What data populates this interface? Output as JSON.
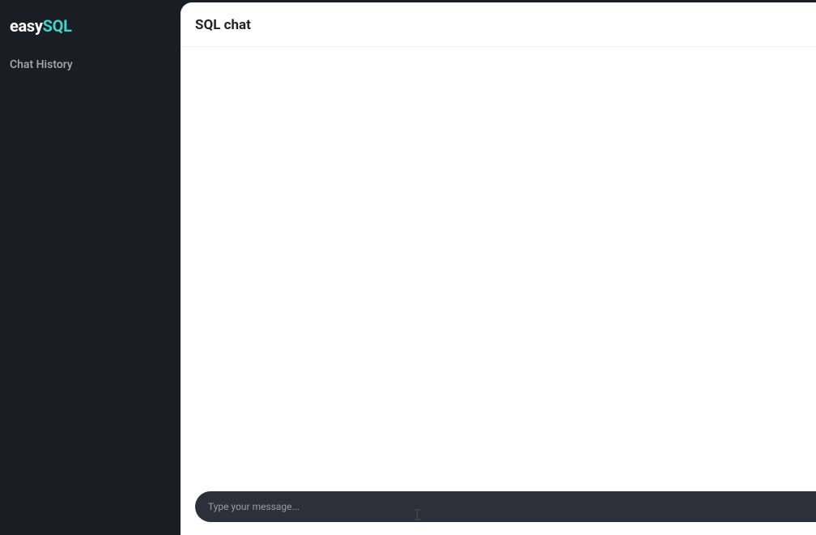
{
  "brand": {
    "part1": "easy",
    "part2": "SQL"
  },
  "sidebar": {
    "section_title": "Chat History"
  },
  "main": {
    "title": "SQL chat"
  },
  "input": {
    "placeholder": "Type your message...",
    "value": ""
  }
}
